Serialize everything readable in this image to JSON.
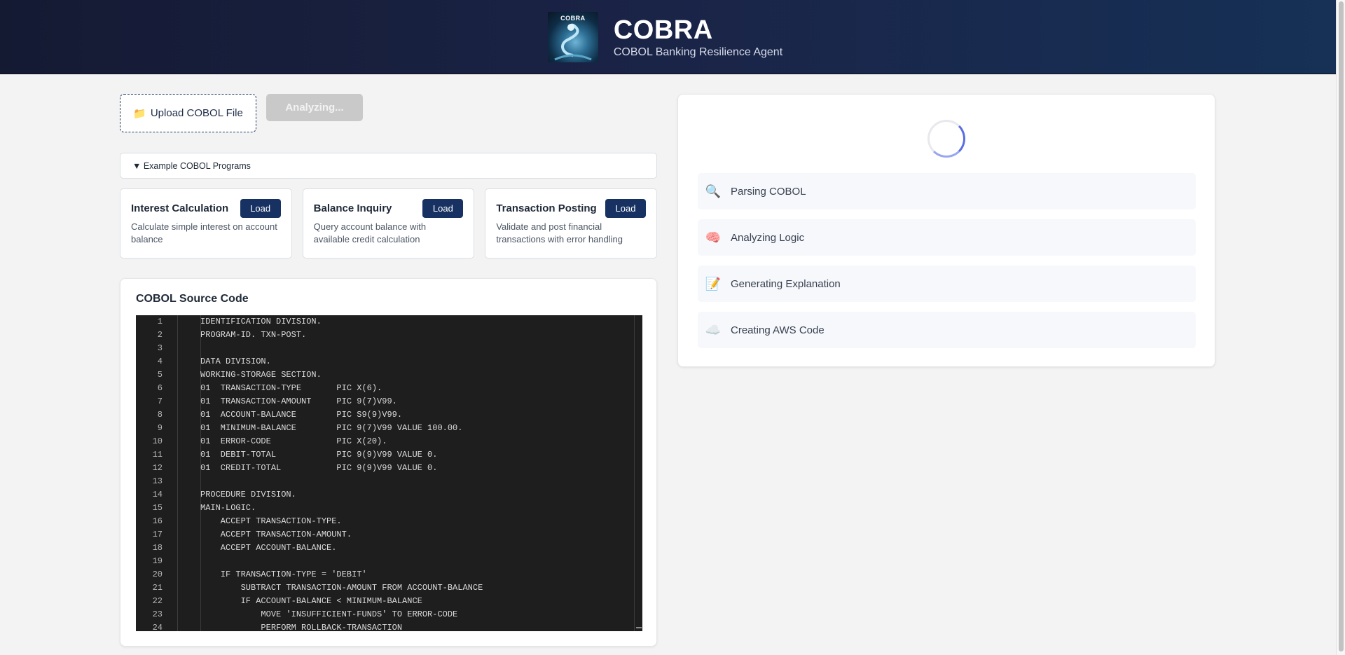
{
  "header": {
    "logo_text": "COBRA",
    "title": "COBRA",
    "subtitle": "COBOL Banking Resilience Agent"
  },
  "actions": {
    "upload_icon": "📁",
    "upload_label": "Upload COBOL File",
    "analyze_label": "Analyzing..."
  },
  "examples": {
    "toggle_label": "▼ Example COBOL Programs",
    "cards": [
      {
        "title": "Interest Calculation",
        "load_label": "Load",
        "description": "Calculate simple interest on account balance"
      },
      {
        "title": "Balance Inquiry",
        "load_label": "Load",
        "description": "Query account balance with available credit calculation"
      },
      {
        "title": "Transaction Posting",
        "load_label": "Load",
        "description": "Validate and post financial transactions with error handling"
      }
    ]
  },
  "code": {
    "title": "COBOL Source Code",
    "lines": [
      "IDENTIFICATION DIVISION.",
      "PROGRAM-ID. TXN-POST.",
      "",
      "DATA DIVISION.",
      "WORKING-STORAGE SECTION.",
      "01  TRANSACTION-TYPE       PIC X(6).",
      "01  TRANSACTION-AMOUNT     PIC 9(7)V99.",
      "01  ACCOUNT-BALANCE        PIC S9(9)V99.",
      "01  MINIMUM-BALANCE        PIC 9(7)V99 VALUE 100.00.",
      "01  ERROR-CODE             PIC X(20).",
      "01  DEBIT-TOTAL            PIC 9(9)V99 VALUE 0.",
      "01  CREDIT-TOTAL           PIC 9(9)V99 VALUE 0.",
      "",
      "PROCEDURE DIVISION.",
      "MAIN-LOGIC.",
      "    ACCEPT TRANSACTION-TYPE.",
      "    ACCEPT TRANSACTION-AMOUNT.",
      "    ACCEPT ACCOUNT-BALANCE.",
      "",
      "    IF TRANSACTION-TYPE = 'DEBIT'",
      "        SUBTRACT TRANSACTION-AMOUNT FROM ACCOUNT-BALANCE",
      "        IF ACCOUNT-BALANCE < MINIMUM-BALANCE",
      "            MOVE 'INSUFFICIENT-FUNDS' TO ERROR-CODE",
      "            PERFORM ROLLBACK-TRANSACTION"
    ]
  },
  "progress": {
    "steps": [
      {
        "icon": "🔍",
        "icon_name": "magnifier-icon",
        "label": "Parsing COBOL"
      },
      {
        "icon": "🧠",
        "icon_name": "brain-icon",
        "label": "Analyzing Logic"
      },
      {
        "icon": "📝",
        "icon_name": "memo-icon",
        "label": "Generating Explanation"
      },
      {
        "icon": "☁️",
        "icon_name": "cloud-icon",
        "label": "Creating AWS Code"
      }
    ]
  },
  "colors": {
    "header_bg": "#1a2447",
    "primary": "#173262",
    "disabled": "#c9c9c9",
    "spinner": "#5b6ee1",
    "editor_bg": "#1e1e1e"
  }
}
